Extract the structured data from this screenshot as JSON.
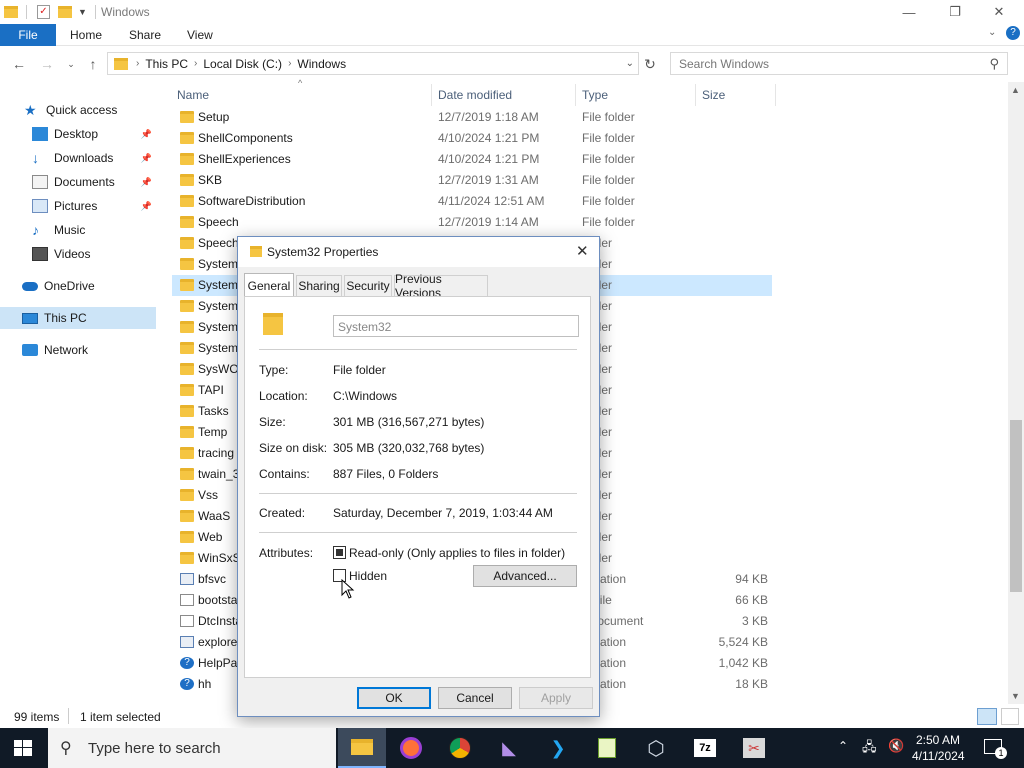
{
  "window": {
    "title": "Windows",
    "minimize": "—",
    "maximize": "❐",
    "close": "✕"
  },
  "ribbon": {
    "file": "File",
    "tabs": [
      "Home",
      "Share",
      "View"
    ],
    "help": "?"
  },
  "address": {
    "crumbs": [
      "This PC",
      "Local Disk (C:)",
      "Windows"
    ],
    "search_placeholder": "Search Windows"
  },
  "nav": [
    {
      "label": "Quick access",
      "icon": "star-icon",
      "pinned": false
    },
    {
      "label": "Desktop",
      "icon": "desktop-icon",
      "pinned": true
    },
    {
      "label": "Downloads",
      "icon": "download-icon",
      "pinned": true
    },
    {
      "label": "Documents",
      "icon": "documents-icon",
      "pinned": true
    },
    {
      "label": "Pictures",
      "icon": "pictures-icon",
      "pinned": true
    },
    {
      "label": "Music",
      "icon": "music-icon",
      "pinned": false
    },
    {
      "label": "Videos",
      "icon": "videos-icon",
      "pinned": false
    },
    {
      "label": "OneDrive",
      "icon": "cloud-icon",
      "pinned": false
    },
    {
      "label": "This PC",
      "icon": "pc-icon",
      "pinned": false,
      "selected": true
    },
    {
      "label": "Network",
      "icon": "network-icon",
      "pinned": false
    }
  ],
  "columns": {
    "name": "Name",
    "date": "Date modified",
    "type": "Type",
    "size": "Size"
  },
  "files": [
    {
      "name": "Setup",
      "date": "12/7/2019 1:18 AM",
      "type": "File folder",
      "size": "",
      "kind": "folder"
    },
    {
      "name": "ShellComponents",
      "date": "4/10/2024 1:21 PM",
      "type": "File folder",
      "size": "",
      "kind": "folder"
    },
    {
      "name": "ShellExperiences",
      "date": "4/10/2024 1:21 PM",
      "type": "File folder",
      "size": "",
      "kind": "folder"
    },
    {
      "name": "SKB",
      "date": "12/7/2019 1:31 AM",
      "type": "File folder",
      "size": "",
      "kind": "folder"
    },
    {
      "name": "SoftwareDistribution",
      "date": "4/11/2024 12:51 AM",
      "type": "File folder",
      "size": "",
      "kind": "folder"
    },
    {
      "name": "Speech",
      "date": "12/7/2019 1:14 AM",
      "type": "File folder",
      "size": "",
      "kind": "folder"
    },
    {
      "name": "Speech_",
      "date": "",
      "type": "folder",
      "size": "",
      "kind": "folder"
    },
    {
      "name": "System",
      "date": "",
      "type": "folder",
      "size": "",
      "kind": "folder"
    },
    {
      "name": "System3",
      "date": "",
      "type": "folder",
      "size": "",
      "kind": "folder",
      "selected": true
    },
    {
      "name": "System",
      "date": "",
      "type": "folder",
      "size": "",
      "kind": "folder"
    },
    {
      "name": "SystemI",
      "date": "",
      "type": "folder",
      "size": "",
      "kind": "folder"
    },
    {
      "name": "SystemT",
      "date": "",
      "type": "folder",
      "size": "",
      "kind": "folder"
    },
    {
      "name": "SysWOW",
      "date": "",
      "type": "folder",
      "size": "",
      "kind": "folder"
    },
    {
      "name": "TAPI",
      "date": "",
      "type": "folder",
      "size": "",
      "kind": "folder"
    },
    {
      "name": "Tasks",
      "date": "",
      "type": "folder",
      "size": "",
      "kind": "folder"
    },
    {
      "name": "Temp",
      "date": "",
      "type": "folder",
      "size": "",
      "kind": "folder"
    },
    {
      "name": "tracing",
      "date": "",
      "type": "folder",
      "size": "",
      "kind": "folder"
    },
    {
      "name": "twain_3",
      "date": "",
      "type": "folder",
      "size": "",
      "kind": "folder"
    },
    {
      "name": "Vss",
      "date": "",
      "type": "folder",
      "size": "",
      "kind": "folder"
    },
    {
      "name": "WaaS",
      "date": "",
      "type": "folder",
      "size": "",
      "kind": "folder"
    },
    {
      "name": "Web",
      "date": "",
      "type": "folder",
      "size": "",
      "kind": "folder"
    },
    {
      "name": "WinSxS",
      "date": "",
      "type": "folder",
      "size": "",
      "kind": "folder"
    },
    {
      "name": "bfsvc",
      "date": "",
      "type": "plication",
      "size": "94 KB",
      "kind": "app"
    },
    {
      "name": "bootsta",
      "date": "",
      "type": "T File",
      "size": "66 KB",
      "kind": "doc"
    },
    {
      "name": "DtcInsta",
      "date": "",
      "type": "t Document",
      "size": "3 KB",
      "kind": "doc"
    },
    {
      "name": "explore",
      "date": "",
      "type": "plication",
      "size": "5,524 KB",
      "kind": "app"
    },
    {
      "name": "HelpPa",
      "date": "",
      "type": "plication",
      "size": "1,042 KB",
      "kind": "help"
    },
    {
      "name": "hh",
      "date": "",
      "type": "plication",
      "size": "18 KB",
      "kind": "help"
    }
  ],
  "status": {
    "items": "99 items",
    "selected": "1 item selected"
  },
  "dialog": {
    "title": "System32 Properties",
    "tabs": [
      "General",
      "Sharing",
      "Security",
      "Previous Versions"
    ],
    "name_value": "System32",
    "rows": [
      {
        "label": "Type:",
        "value": "File folder"
      },
      {
        "label": "Location:",
        "value": "C:\\Windows"
      },
      {
        "label": "Size:",
        "value": "301 MB (316,567,271 bytes)"
      },
      {
        "label": "Size on disk:",
        "value": "305 MB (320,032,768 bytes)"
      },
      {
        "label": "Contains:",
        "value": "887 Files, 0 Folders"
      }
    ],
    "created_label": "Created:",
    "created_value": "Saturday, December 7, 2019, 1:03:44 AM",
    "attributes_label": "Attributes:",
    "readonly_label": "Read-only (Only applies to files in folder)",
    "hidden_label": "Hidden",
    "advanced": "Advanced...",
    "ok": "OK",
    "cancel": "Cancel",
    "apply": "Apply"
  },
  "taskbar": {
    "search": "Type here to search",
    "time": "2:50 AM",
    "date": "4/11/2024",
    "apps": [
      "file-explorer",
      "firefox",
      "chrome",
      "visual-studio",
      "vscode",
      "notepad-plus",
      "virtualbox",
      "7zip",
      "snipping"
    ]
  }
}
